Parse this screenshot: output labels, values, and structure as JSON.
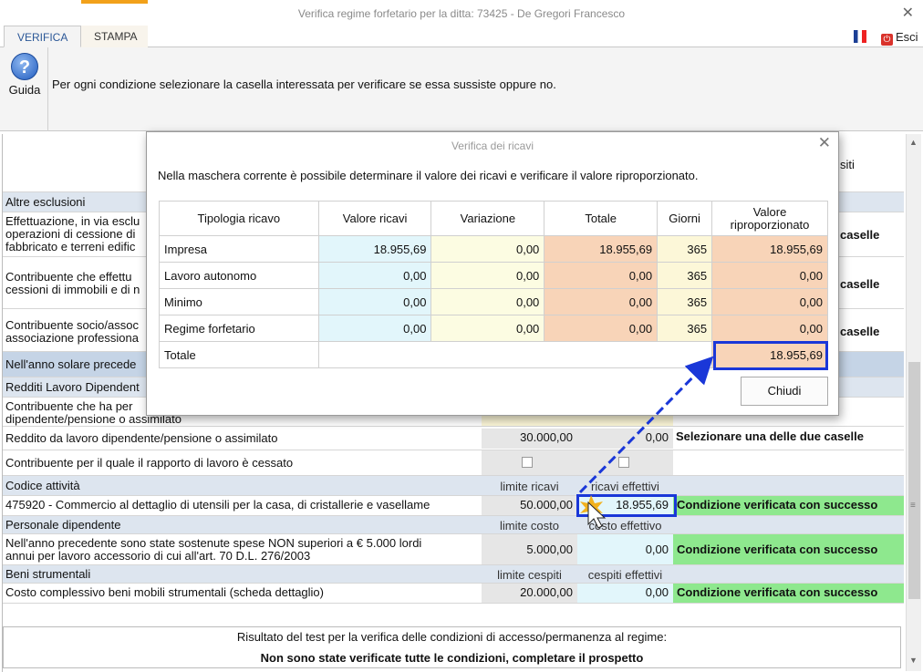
{
  "window": {
    "title": "Verifica regime forfetario per la ditta: 73425 - De Gregori Francesco",
    "close": "✕"
  },
  "tabs": [
    "VERIFICA",
    "STAMPA"
  ],
  "toolbar": {
    "esci": "Esci",
    "guida": "Guida",
    "instruction": "Per ogni condizione selezionare la casella interessata per verificare se essa sussiste oppure no."
  },
  "bg": {
    "frag_siti": "siti",
    "altre_esclusioni": "Altre esclusioni",
    "eff_1": "Effettuazione, in via esclu",
    "eff_2": "operazioni di cessione di",
    "eff_3": "fabbricato e terreni edific",
    "casel": "caselle",
    "contr1_1": "Contribuente che effettu",
    "contr1_2": "cessioni di immobili e di n",
    "contr2_1": "Contribuente socio/assoc",
    "contr2_2": "associazione professiona",
    "nell_anno": "Nell'anno solare precede",
    "redditi": "Redditi Lavoro Dipendent",
    "contr3_1": "Contribuente che ha per",
    "contr3_2": "dipendente/pensione o assimilato",
    "reddito_lbl": "Reddito da lavoro dipendente/pensione o assimilato",
    "reddito_lim": "30.000,00",
    "reddito_eff": "0,00",
    "sel_due": "Selezionare una delle due caselle",
    "cessato": "Contribuente per il quale il rapporto di lavoro è cessato",
    "codice": "Codice attività",
    "limite_ricavi": "limite ricavi",
    "ricavi_eff": "ricavi effettivi",
    "attivita": "475920 - Commercio al dettaglio di utensili per la casa, di cristallerie e vasellame",
    "att_lim": "50.000,00",
    "att_eff": "18.955,69",
    "ok": "Condizione verificata con successo",
    "personale": "Personale dipendente",
    "limite_costo": "limite costo",
    "costo_eff": "costo effettivo",
    "spese_1": "Nell'anno precedente sono state sostenute spese NON superiori a € 5.000 lordi",
    "spese_2": "annui per lavoro accessorio di cui all'art. 70 D.L. 276/2003",
    "spese_lim": "5.000,00",
    "spese_eff": "0,00",
    "beni": "Beni strumentali",
    "limite_cespiti": "limite cespiti",
    "cespiti_eff": "cespiti effettivi",
    "costo_beni": "Costo complessivo beni mobili strumentali (scheda dettaglio)",
    "beni_lim": "20.000,00",
    "beni_eff": "0,00",
    "result_1": "Risultato del test per la verifica delle condizioni di accesso/permanenza al regime:",
    "result_2": "Non sono state verificate tutte le condizioni, completare il prospetto"
  },
  "modal": {
    "title": "Verifica dei ricavi",
    "desc": "Nella maschera corrente è possibile determinare il valore dei ricavi e verificare il valore riproporzionato.",
    "headers": [
      "Tipologia ricavo",
      "Valore ricavi",
      "Variazione",
      "Totale",
      "Giorni",
      "Valore riproporzionato"
    ],
    "rows": [
      [
        "Impresa",
        "18.955,69",
        "0,00",
        "18.955,69",
        "365",
        "18.955,69"
      ],
      [
        "Lavoro autonomo",
        "0,00",
        "0,00",
        "0,00",
        "365",
        "0,00"
      ],
      [
        "Minimo",
        "0,00",
        "0,00",
        "0,00",
        "365",
        "0,00"
      ],
      [
        "Regime forfetario",
        "0,00",
        "0,00",
        "0,00",
        "365",
        "0,00"
      ]
    ],
    "total_label": "Totale",
    "total_value": "18.955,69",
    "chiudi": "Chiudi"
  }
}
